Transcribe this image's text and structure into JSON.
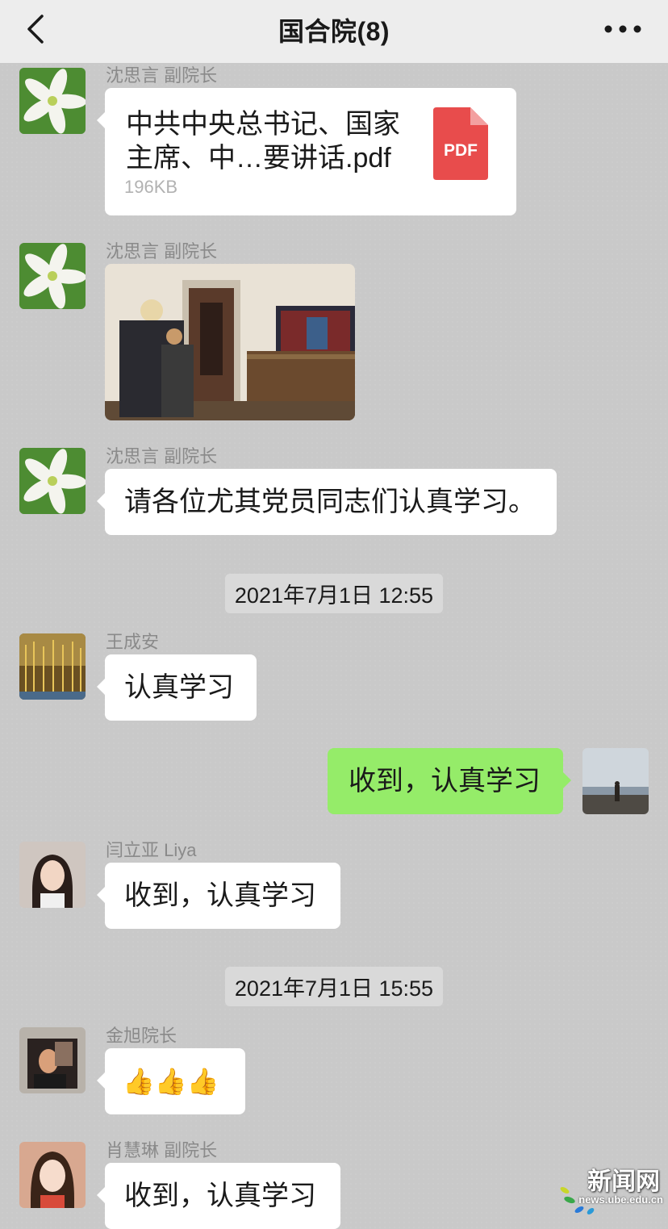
{
  "header": {
    "title": "国合院(8)"
  },
  "icons": {
    "back": "chevron-left-icon",
    "more": "more-dots-icon",
    "file": "pdf-icon"
  },
  "colors": {
    "header_bg": "#ededed",
    "chat_bg": "#c9c9c9",
    "self_bubble": "#95ec69",
    "pdf_red": "#e84c4c"
  },
  "messages": [
    {
      "sender": "沈思言 副院长",
      "type": "file",
      "file_name_line1": "中共中央总书记、国家",
      "file_name_line2": "主席、中…要讲话.pdf",
      "file_size": "196KB",
      "file_icon_label": "PDF"
    },
    {
      "sender": "沈思言 副院长",
      "type": "image"
    },
    {
      "sender": "沈思言 副院长",
      "type": "text",
      "text": "请各位尤其党员同志们认真学习。"
    },
    {
      "type": "time",
      "text": "2021年7月1日 12:55"
    },
    {
      "sender": "王成安",
      "type": "text",
      "text": "认真学习"
    },
    {
      "sender": "",
      "type": "text",
      "self": true,
      "text": "收到，认真学习"
    },
    {
      "sender": "闫立亚 Liya",
      "type": "text",
      "text": "收到，认真学习"
    },
    {
      "type": "time",
      "text": "2021年7月1日 15:55"
    },
    {
      "sender": "金旭院长",
      "type": "text",
      "text": "👍👍👍"
    },
    {
      "sender": "肖慧琳 副院长",
      "type": "text",
      "text": "收到，认真学习"
    }
  ],
  "watermark": {
    "text": "新闻网",
    "url": "news.ube.edu.cn"
  }
}
